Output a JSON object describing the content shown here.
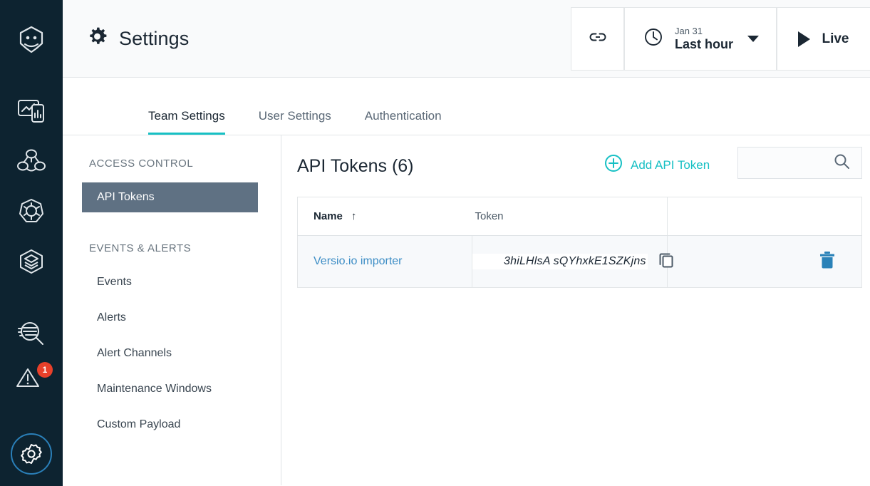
{
  "rail": {
    "items": [
      {
        "name": "logo-robot-icon",
        "label": "Robot logo"
      },
      {
        "name": "dashboards-icon",
        "label": "Dashboards"
      },
      {
        "name": "hosts-icon",
        "label": "Hosts"
      },
      {
        "name": "kubernetes-icon",
        "label": "Kubernetes"
      },
      {
        "name": "layers-icon",
        "label": "Infrastructure"
      },
      {
        "name": "logs-search-icon",
        "label": "Logs"
      },
      {
        "name": "alerts-warning-icon",
        "label": "Alerts"
      },
      {
        "name": "settings-gear-icon",
        "label": "Settings"
      }
    ],
    "alert_badge_count": "1"
  },
  "header": {
    "title": "Settings",
    "gear_icon": "gear-icon",
    "link_icon": "link-icon",
    "clock_icon": "clock-icon",
    "time_date": "Jan 31",
    "time_range": "Last hour",
    "live_label": "Live"
  },
  "tabs": [
    {
      "label": "Team Settings",
      "active": true
    },
    {
      "label": "User Settings",
      "active": false
    },
    {
      "label": "Authentication",
      "active": false
    }
  ],
  "subnav": {
    "groups": [
      {
        "label": "ACCESS CONTROL",
        "items": [
          {
            "label": "API Tokens",
            "selected": true
          }
        ]
      },
      {
        "label": "EVENTS & ALERTS",
        "items": [
          {
            "label": "Events",
            "selected": false
          },
          {
            "label": "Alerts",
            "selected": false
          },
          {
            "label": "Alert Channels",
            "selected": false
          },
          {
            "label": "Maintenance Windows",
            "selected": false
          },
          {
            "label": "Custom Payload",
            "selected": false
          }
        ]
      }
    ]
  },
  "content": {
    "title": "API Tokens (6)",
    "add_button_label": "Add API Token",
    "add_icon": "plus-circle-icon",
    "search_placeholder": "",
    "search_value": "",
    "search_icon": "search-icon",
    "table": {
      "columns": [
        {
          "label": "Name",
          "sort": "↑"
        },
        {
          "label": "Token"
        }
      ],
      "rows": [
        {
          "name": "Versio.io importer",
          "token": "3hiLHlsA sQYhxkE1SZKjns",
          "copy_icon": "copy-icon",
          "delete_icon": "trash-icon"
        }
      ]
    }
  },
  "colors": {
    "rail_bg": "#0d2330",
    "accent_teal": "#17c0c4",
    "selected_nav": "#5f7183",
    "link_blue": "#3c8dc5",
    "trash_blue": "#2a82b8",
    "badge_red": "#e8402a"
  }
}
